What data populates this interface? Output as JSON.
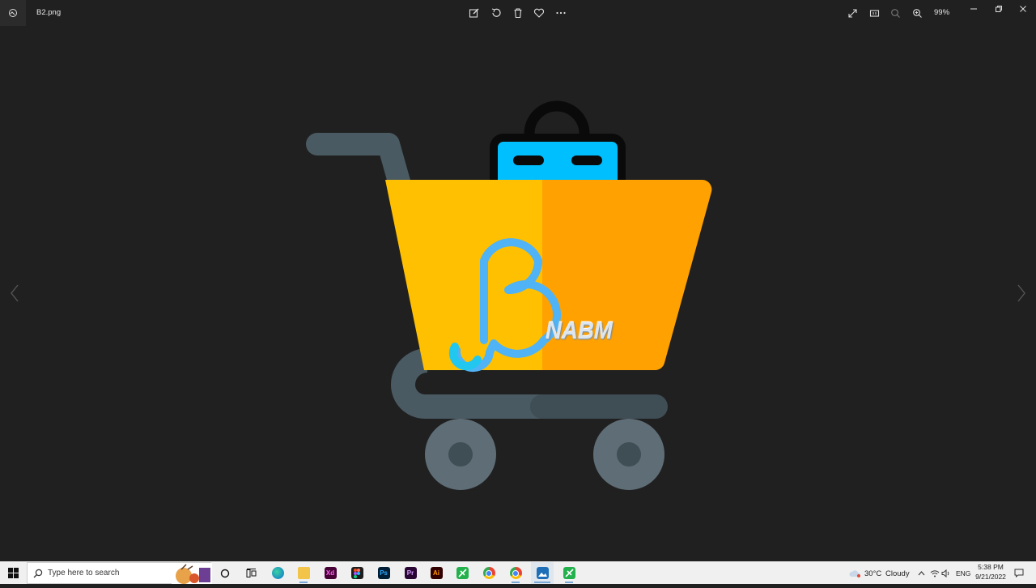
{
  "window": {
    "file_name": "B2.png",
    "zoom_level": "99%",
    "toolbar_icons": [
      "edit-icon",
      "rotate-icon",
      "delete-icon",
      "favorite-icon",
      "more-icon"
    ],
    "right_icons": [
      "fullscreen-icon",
      "actual-size-icon",
      "zoom-out-icon",
      "zoom-in-icon"
    ],
    "window_controls": [
      "minimize-icon",
      "restore-icon",
      "close-icon"
    ]
  },
  "image": {
    "logo_text": "NABM"
  },
  "taskbar": {
    "search_placeholder": "Type here to search",
    "apps": [
      {
        "name": "edge",
        "label": ""
      },
      {
        "name": "file-explorer",
        "label": ""
      },
      {
        "name": "adobe-xd",
        "label": "Xd"
      },
      {
        "name": "figma",
        "label": ""
      },
      {
        "name": "photoshop",
        "label": "Ps"
      },
      {
        "name": "premiere",
        "label": "Pr"
      },
      {
        "name": "illustrator",
        "label": "Ai"
      },
      {
        "name": "green-app-1",
        "label": ""
      },
      {
        "name": "chrome",
        "label": ""
      },
      {
        "name": "chrome-2",
        "label": ""
      },
      {
        "name": "photos",
        "label": ""
      },
      {
        "name": "green-app-2",
        "label": ""
      }
    ],
    "weather": {
      "temp": "30°C",
      "condition": "Cloudy"
    },
    "language": "ENG",
    "time": "5:38 PM",
    "date": "9/21/2022"
  },
  "colors": {
    "background": "#202020",
    "cart_yellow": "#FFC001",
    "cart_orange": "#FFA100",
    "cart_frame": "#4A5A62",
    "bag_blue": "#00BFFF",
    "logo_blue": "#4FB3F5",
    "wheel": "#5F6E76"
  }
}
